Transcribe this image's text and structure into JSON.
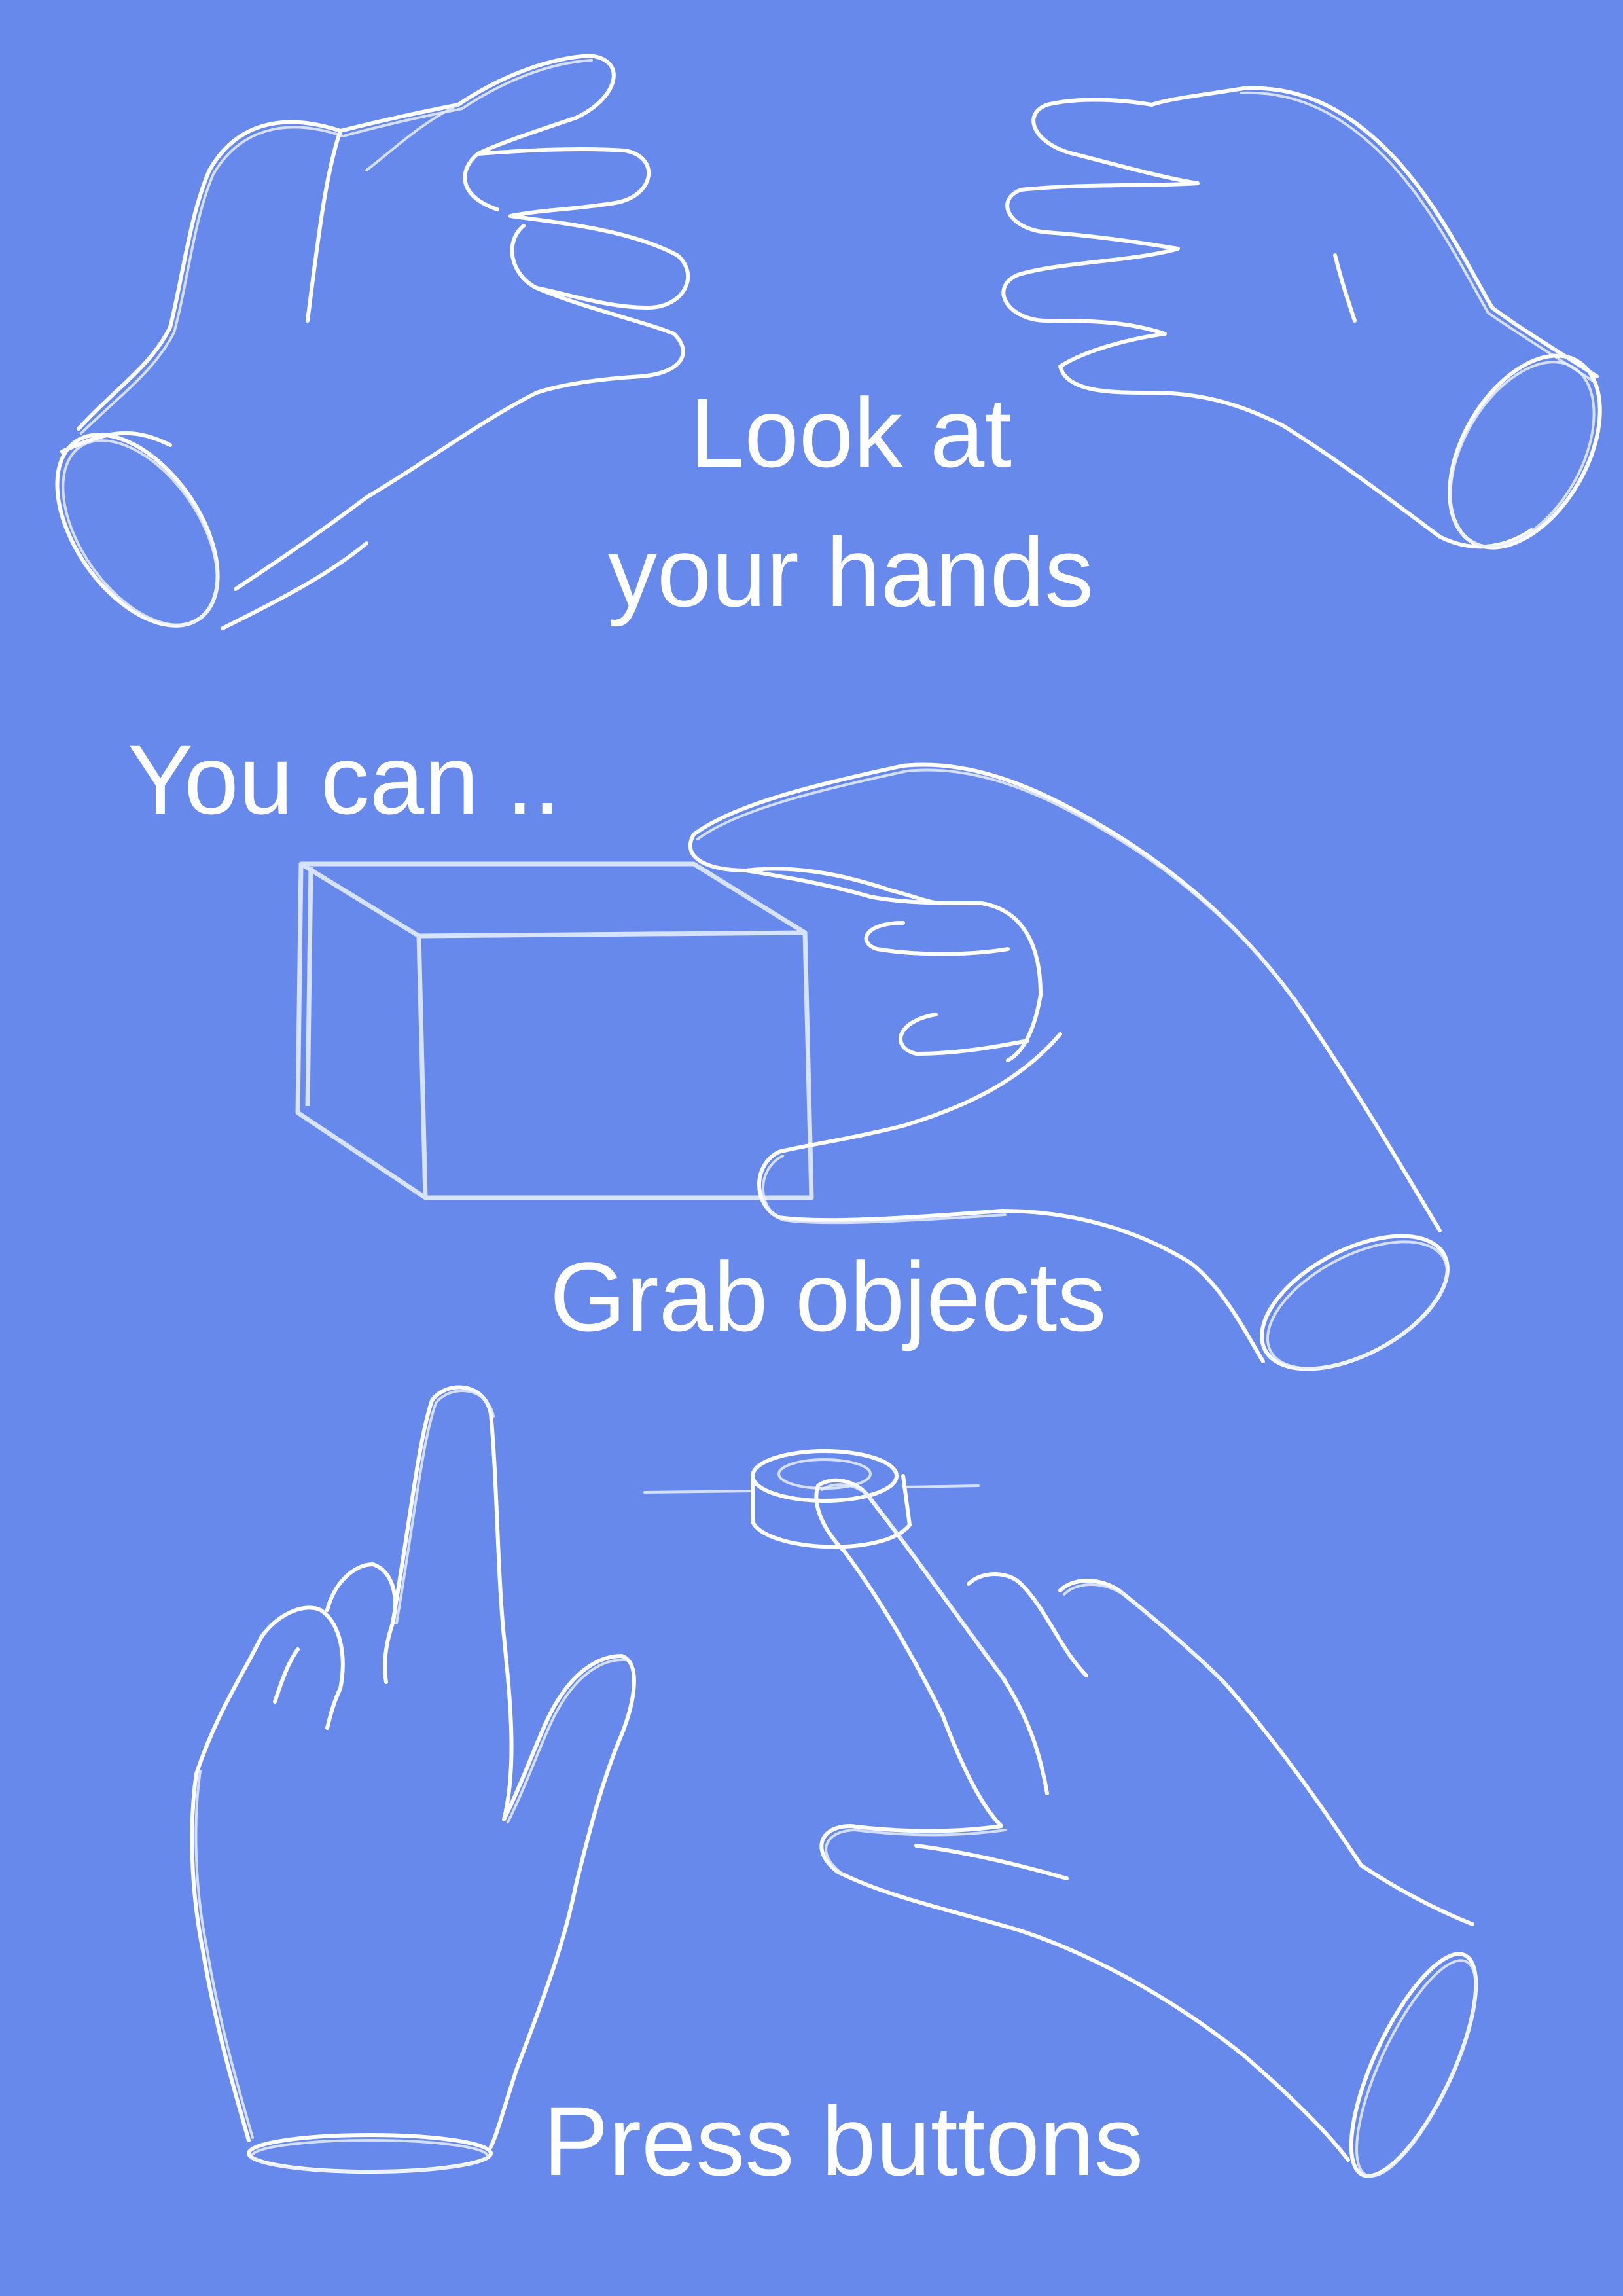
{
  "captions": {
    "look_line1": "Look at",
    "look_line2": "your hands",
    "you_can": "You can ..",
    "grab": "Grab objects",
    "press": "Press buttons"
  },
  "illustrations": [
    "open-hand-left",
    "open-hand-right",
    "grabbing-hand",
    "box",
    "raised-finger-hand",
    "pointing-hand",
    "round-button"
  ],
  "colors": {
    "background": "#6889ec",
    "line": "#ffffff",
    "text": "#ffffff"
  }
}
